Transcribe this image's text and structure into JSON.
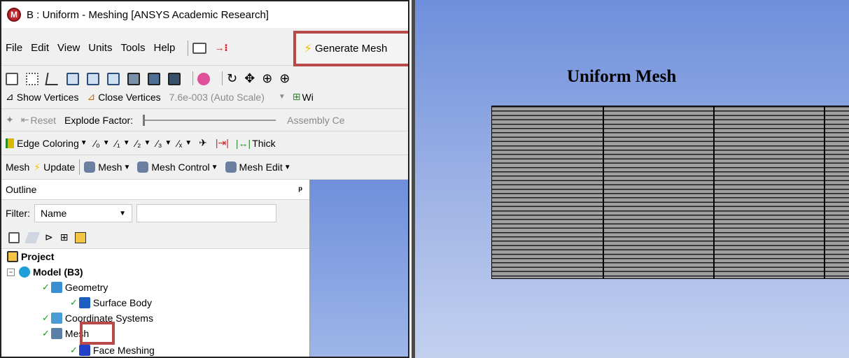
{
  "window": {
    "logo_letter": "M",
    "title": "B : Uniform - Meshing [ANSYS Academic Research]"
  },
  "menubar": {
    "items": [
      "File",
      "Edit",
      "View",
      "Units",
      "Tools",
      "Help"
    ],
    "generate_mesh_label": "Generate Mesh"
  },
  "toolbar2": {
    "icons": [
      "select-mode-icon",
      "point-select-icon",
      "cursor-select-icon",
      "vertex-select-icon",
      "edge-select-icon",
      "face-select-icon",
      "body-select-icon",
      "node-select-icon",
      "element-select-icon",
      "extend-selection-icon",
      "rotate-icon",
      "pan-icon",
      "zoom-icon",
      "zoom-box-icon"
    ]
  },
  "toolbar3": {
    "show_vertices": "Show Vertices",
    "close_vertices": "Close Vertices",
    "scale_value": "7.6e-003 (Auto Scale)",
    "wireframe_partial": "Wi"
  },
  "toolbar4": {
    "reset": "Reset",
    "explode_factor": "Explode Factor:",
    "assembly_partial": "Assembly Ce"
  },
  "toolbar5": {
    "edge_coloring": "Edge Coloring",
    "thick_partial": "Thick"
  },
  "toolbar6": {
    "mesh": "Mesh",
    "update": "Update",
    "mesh_dropdown": "Mesh",
    "mesh_control": "Mesh Control",
    "mesh_edit": "Mesh Edit"
  },
  "outline": {
    "header": "Outline",
    "pin": "ᵖ",
    "filter_label": "Filter:",
    "filter_value": "Name"
  },
  "tree": {
    "project": "Project",
    "model": "Model (B3)",
    "geometry": "Geometry",
    "surface_body": "Surface Body",
    "coordinate_systems": "Coordinate Systems",
    "mesh": "Mesh",
    "face_meshing": "Face Meshing"
  },
  "viewport": {
    "title": "Uniform Mesh"
  },
  "colors": {
    "highlight": "#b84a4a",
    "viewport_top": "#6e8fdc",
    "viewport_bottom": "#c3d1ef"
  }
}
